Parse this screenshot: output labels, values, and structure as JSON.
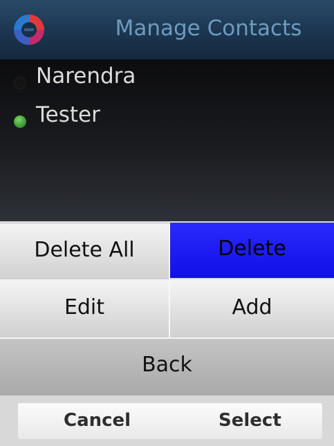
{
  "header": {
    "title": "Manage Contacts",
    "logo_icon": "app-logo-icon"
  },
  "contacts": [
    {
      "name": "Narendra",
      "status": "offline",
      "status_color": "#141414"
    },
    {
      "name": "Tester",
      "status": "online",
      "status_color": "#4caf3c"
    }
  ],
  "menu": {
    "delete_all": "Delete All",
    "delete": "Delete",
    "edit": "Edit",
    "add": "Add",
    "back": "Back",
    "selected_item": "Delete",
    "selected_color": "#1a1aff"
  },
  "softkeys": {
    "left": "Cancel",
    "right": "Select"
  },
  "colors": {
    "title_text": "#6f9bbf",
    "header_bg": "#1d3954",
    "contact_text": "#dcdcdc"
  }
}
